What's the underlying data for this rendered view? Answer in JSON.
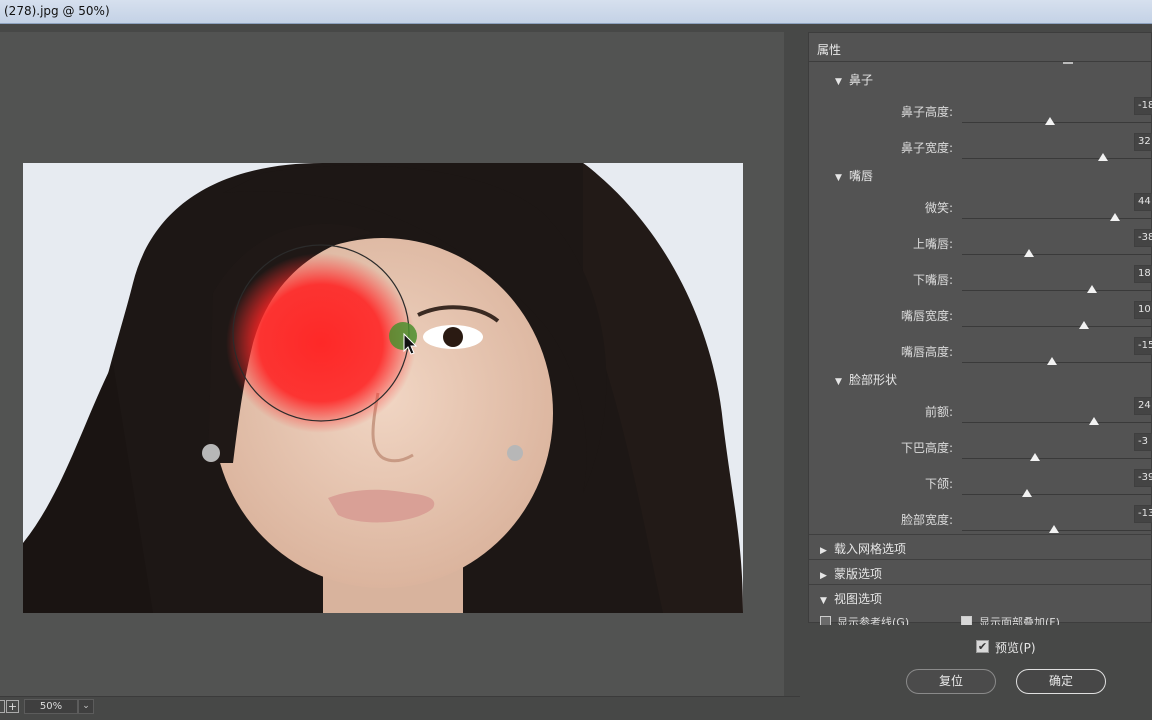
{
  "window": {
    "title": "(278).jpg @ 50%)"
  },
  "zoom": {
    "value": "50%",
    "minus": "-",
    "plus": "+",
    "dropdown": "⌄"
  },
  "panel": {
    "title": "属性",
    "sections": [
      {
        "name": "鼻子",
        "sliders": [
          {
            "label": "鼻子高度:",
            "value": "-18",
            "pos": 0.46
          },
          {
            "label": "鼻子宽度:",
            "value": "32",
            "pos": 0.74
          }
        ]
      },
      {
        "name": "嘴唇",
        "sliders": [
          {
            "label": "微笑:",
            "value": "44",
            "pos": 0.8
          },
          {
            "label": "上嘴唇:",
            "value": "-38",
            "pos": 0.35
          },
          {
            "label": "下嘴唇:",
            "value": "18",
            "pos": 0.68
          },
          {
            "label": "嘴唇宽度:",
            "value": "10",
            "pos": 0.64
          },
          {
            "label": "嘴唇高度:",
            "value": "-15",
            "pos": 0.47
          }
        ]
      },
      {
        "name": "脸部形状",
        "sliders": [
          {
            "label": "前额:",
            "value": "24",
            "pos": 0.69
          },
          {
            "label": "下巴高度:",
            "value": "-3",
            "pos": 0.38
          },
          {
            "label": "下颌:",
            "value": "-39",
            "pos": 0.34
          },
          {
            "label": "脸部宽度:",
            "value": "-13",
            "pos": 0.48
          }
        ]
      }
    ],
    "collapsed": [
      {
        "label": "载入网格选项",
        "expanded": false
      },
      {
        "label": "蒙版选项",
        "expanded": false
      },
      {
        "label": "视图选项",
        "expanded": true
      }
    ],
    "view_options": [
      {
        "label": "显示参考线(G)",
        "checked": false
      },
      {
        "label": "显示面部叠加(F)",
        "checked": true
      }
    ]
  },
  "preview": {
    "label": "预览(P)",
    "checked": true
  },
  "buttons": {
    "reset": "复位",
    "ok": "确定"
  },
  "glyphs": {
    "expanded": "▼",
    "collapsed": "▶",
    "check": "✔"
  }
}
